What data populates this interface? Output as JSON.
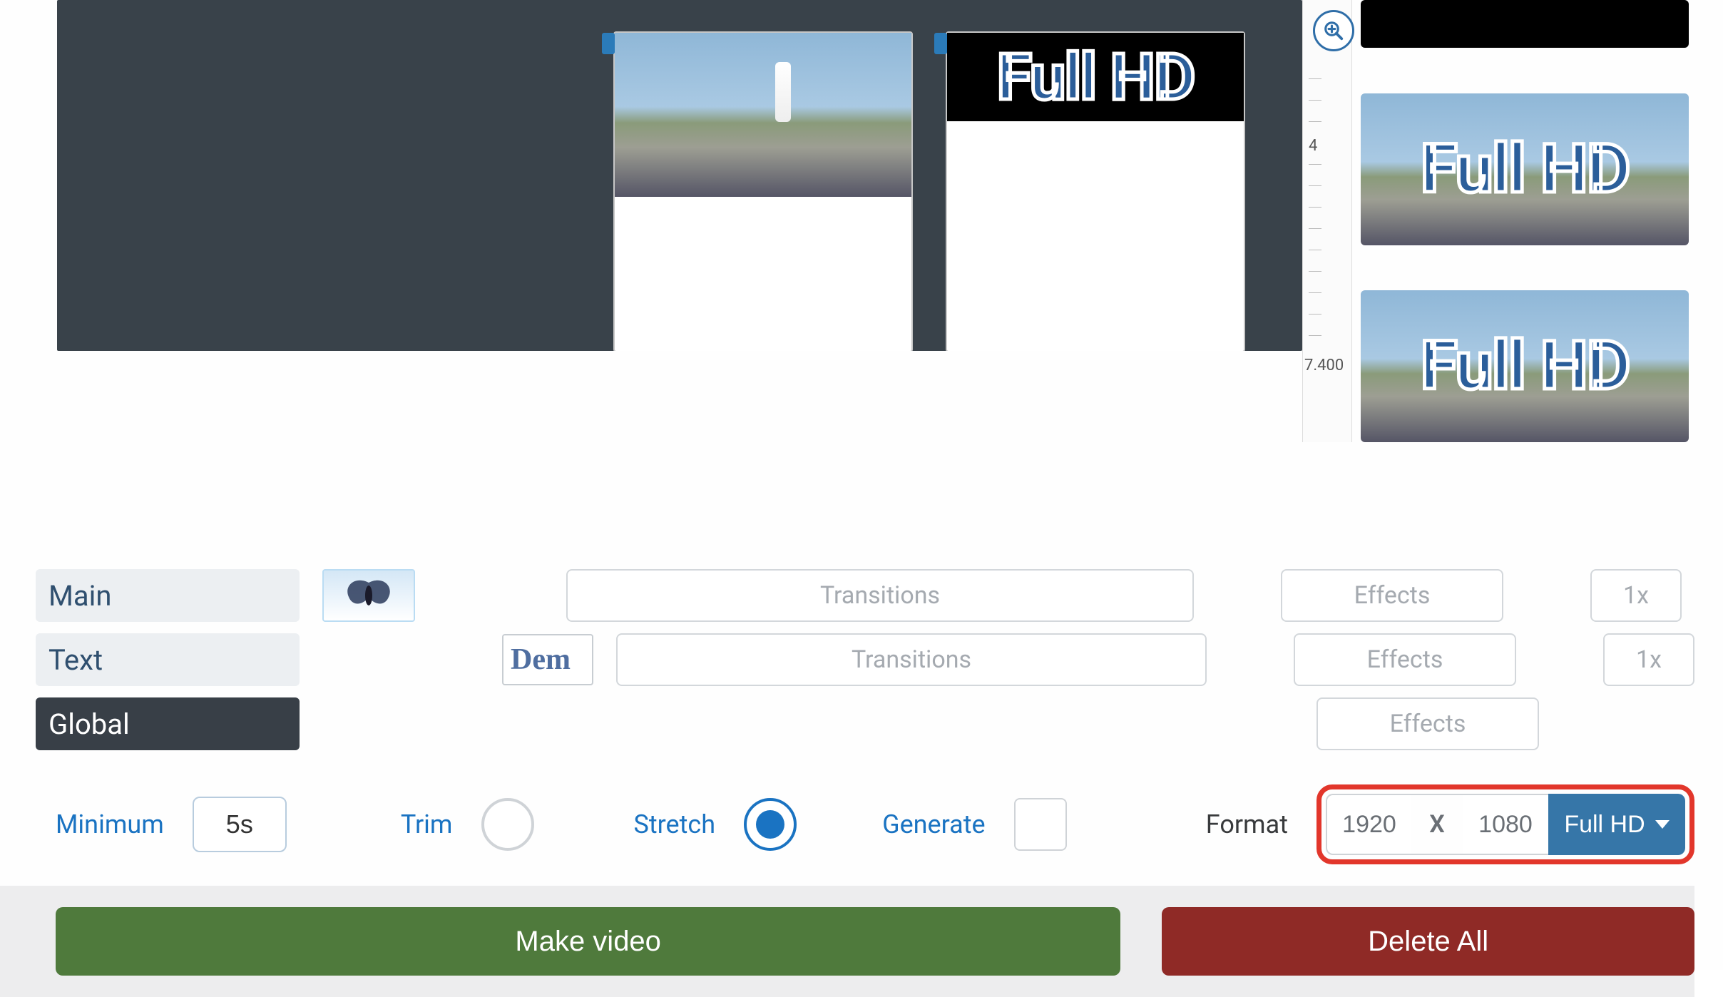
{
  "timeline": {
    "zoom_icon": "zoom-in",
    "ticks": [
      "4",
      "7.400"
    ],
    "clip1_overlay": "",
    "clip2_overlay": "Full HD",
    "strip1_overlay": "Full HD",
    "strip2_overlay": "Full HD"
  },
  "tracks": {
    "main": "Main",
    "text": "Text",
    "global": "Global",
    "transitions": "Transitions",
    "effects": "Effects",
    "speed": "1x",
    "dem": "Dem"
  },
  "controls": {
    "minimum_label": "Minimum",
    "minimum_value": "5s",
    "trim_label": "Trim",
    "stretch_label": "Stretch",
    "generate_label": "Generate",
    "format_label": "Format",
    "width": "1920",
    "x": "X",
    "height": "1080",
    "preset": "Full HD"
  },
  "footer": {
    "make": "Make video",
    "delete": "Delete All"
  },
  "colors": {
    "highlight_border": "#e2362b",
    "primary": "#1a73c2",
    "dd_bg": "#3676a8",
    "make_bg": "#4f7a3c",
    "delete_bg": "#8f2a26"
  }
}
